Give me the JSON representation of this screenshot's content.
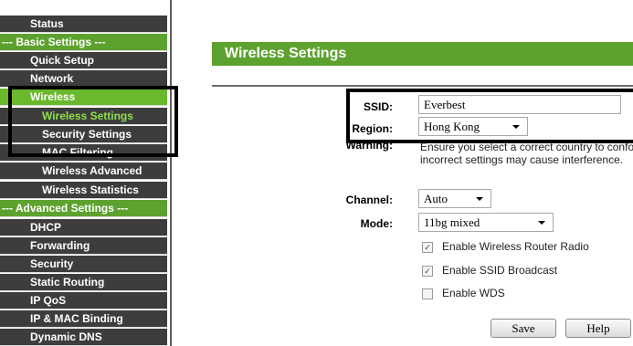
{
  "sidebar": {
    "items": [
      {
        "label": "Status"
      },
      {
        "label": "--- Basic Settings ---"
      },
      {
        "label": "Quick Setup"
      },
      {
        "label": "Network"
      },
      {
        "label": "Wireless"
      },
      {
        "label": "Wireless Settings"
      },
      {
        "label": "Security Settings"
      },
      {
        "label": "MAC Filtering"
      },
      {
        "label": "Wireless Advanced"
      },
      {
        "label": "Wireless Statistics"
      },
      {
        "label": "--- Advanced Settings ---"
      },
      {
        "label": "DHCP"
      },
      {
        "label": "Forwarding"
      },
      {
        "label": "Security"
      },
      {
        "label": "Static Routing"
      },
      {
        "label": "IP QoS"
      },
      {
        "label": "IP & MAC Binding"
      },
      {
        "label": "Dynamic DNS"
      }
    ]
  },
  "main": {
    "title": "Wireless Settings",
    "ssid": {
      "label": "SSID:",
      "value": "Everbest"
    },
    "region": {
      "label": "Region:",
      "value": "Hong Kong"
    },
    "warning": {
      "label": "Warning:",
      "line1": "Ensure you select a correct country to conform",
      "line2": "incorrect settings may cause interference."
    },
    "channel": {
      "label": "Channel:",
      "value": "Auto"
    },
    "mode": {
      "label": "Mode:",
      "value": "11bg mixed"
    },
    "checkboxes": [
      {
        "label": "Enable Wireless Router Radio",
        "checked": true
      },
      {
        "label": "Enable SSID Broadcast",
        "checked": true
      },
      {
        "label": "Enable WDS",
        "checked": false
      }
    ],
    "buttons": {
      "save": "Save",
      "help": "Help"
    }
  },
  "colors": {
    "accent": "#5da22f",
    "active": "#6ab82c",
    "sidebar_bg": "#3d3d3d"
  }
}
